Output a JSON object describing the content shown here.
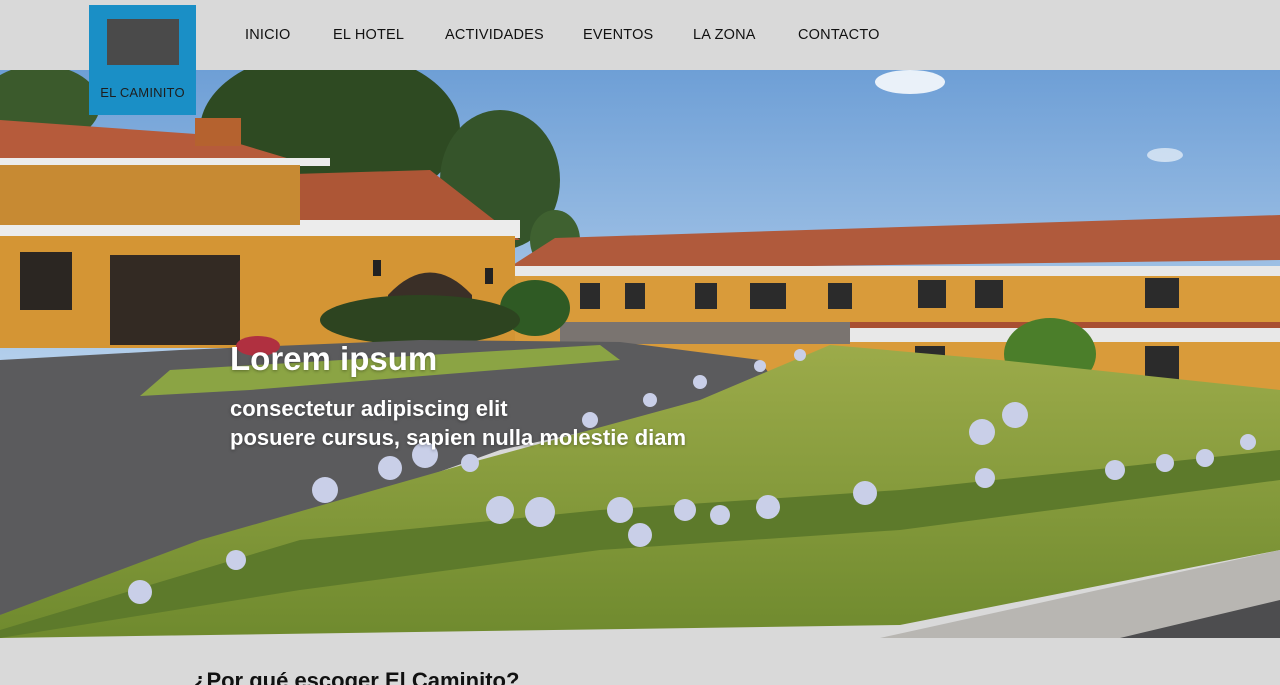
{
  "brand": {
    "name": "EL CAMINITO",
    "accent": "#1a8fc6"
  },
  "nav": {
    "items": [
      {
        "label": "INICIO"
      },
      {
        "label": "EL HOTEL"
      },
      {
        "label": "ACTIVIDADES"
      },
      {
        "label": "EVENTOS"
      },
      {
        "label": "LA ZONA"
      },
      {
        "label": "CONTACTO"
      }
    ]
  },
  "hero": {
    "title": "Lorem ipsum",
    "subtitle_line1": "consectetur adipiscing elit",
    "subtitle_line2": "posuere cursus, sapien nulla molestie diam"
  },
  "section": {
    "heading": "¿Por qué escoger El Caminito?"
  }
}
